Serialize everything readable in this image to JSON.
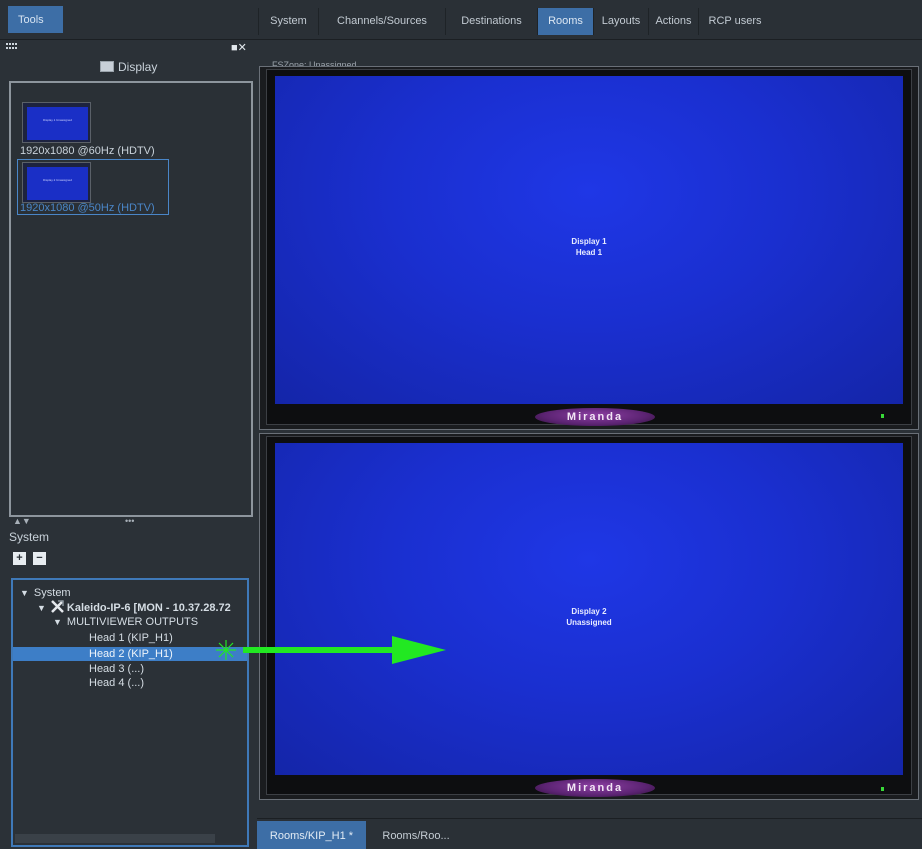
{
  "topbar": {
    "tools_label": "Tools",
    "tabs": [
      {
        "label": "System",
        "active": false
      },
      {
        "label": "Channels/Sources",
        "active": false
      },
      {
        "label": "Destinations",
        "active": false
      },
      {
        "label": "Rooms",
        "active": true
      },
      {
        "label": "Layouts",
        "active": false
      },
      {
        "label": "Actions",
        "active": false
      },
      {
        "label": "RCP users",
        "active": false
      }
    ]
  },
  "left_panel": {
    "close_glyph": "■✕",
    "display_title": "Display",
    "display_icon": "monitor-icon",
    "displays": [
      {
        "thumb_text": "Display 1 Unassigned",
        "resolution": "1920x1080 @60Hz (HDTV)",
        "selected": false
      },
      {
        "thumb_text": "Display 2 Unassigned",
        "resolution": "1920x1080 @50Hz (HDTV)",
        "selected": true
      }
    ],
    "divider_arrows": "▲▼",
    "divider_dots": "•••",
    "system_title": "System",
    "expand_label": "+",
    "collapse_label": "−",
    "tree": {
      "root": "System",
      "device": "Kaleido-IP-6 [MON - 10.37.28.72",
      "group": "MULTIVIEWER OUTPUTS",
      "heads": [
        "Head 1 (KIP_H1)",
        "Head 2 (KIP_H1)",
        "Head 3 (...)",
        "Head 4 (...)"
      ],
      "selected_index": 1
    }
  },
  "main": {
    "zone_label": "FSZone: Unassigned",
    "monitors": [
      {
        "line1": "Display 1",
        "line2": "Head 1",
        "logo": "Miranda"
      },
      {
        "line1": "Display 2",
        "line2": "Unassigned",
        "logo": "Miranda"
      }
    ]
  },
  "bottom_tabs": [
    {
      "label": "Rooms/KIP_H1 *",
      "active": true
    },
    {
      "label": "Rooms/Roo...",
      "active": false
    }
  ],
  "colors": {
    "accent": "#3d6ea6",
    "selection": "#3d7ec7",
    "screen_blue": "#1a2fcf",
    "drag_arrow": "#22e822",
    "led": "#38d938"
  }
}
